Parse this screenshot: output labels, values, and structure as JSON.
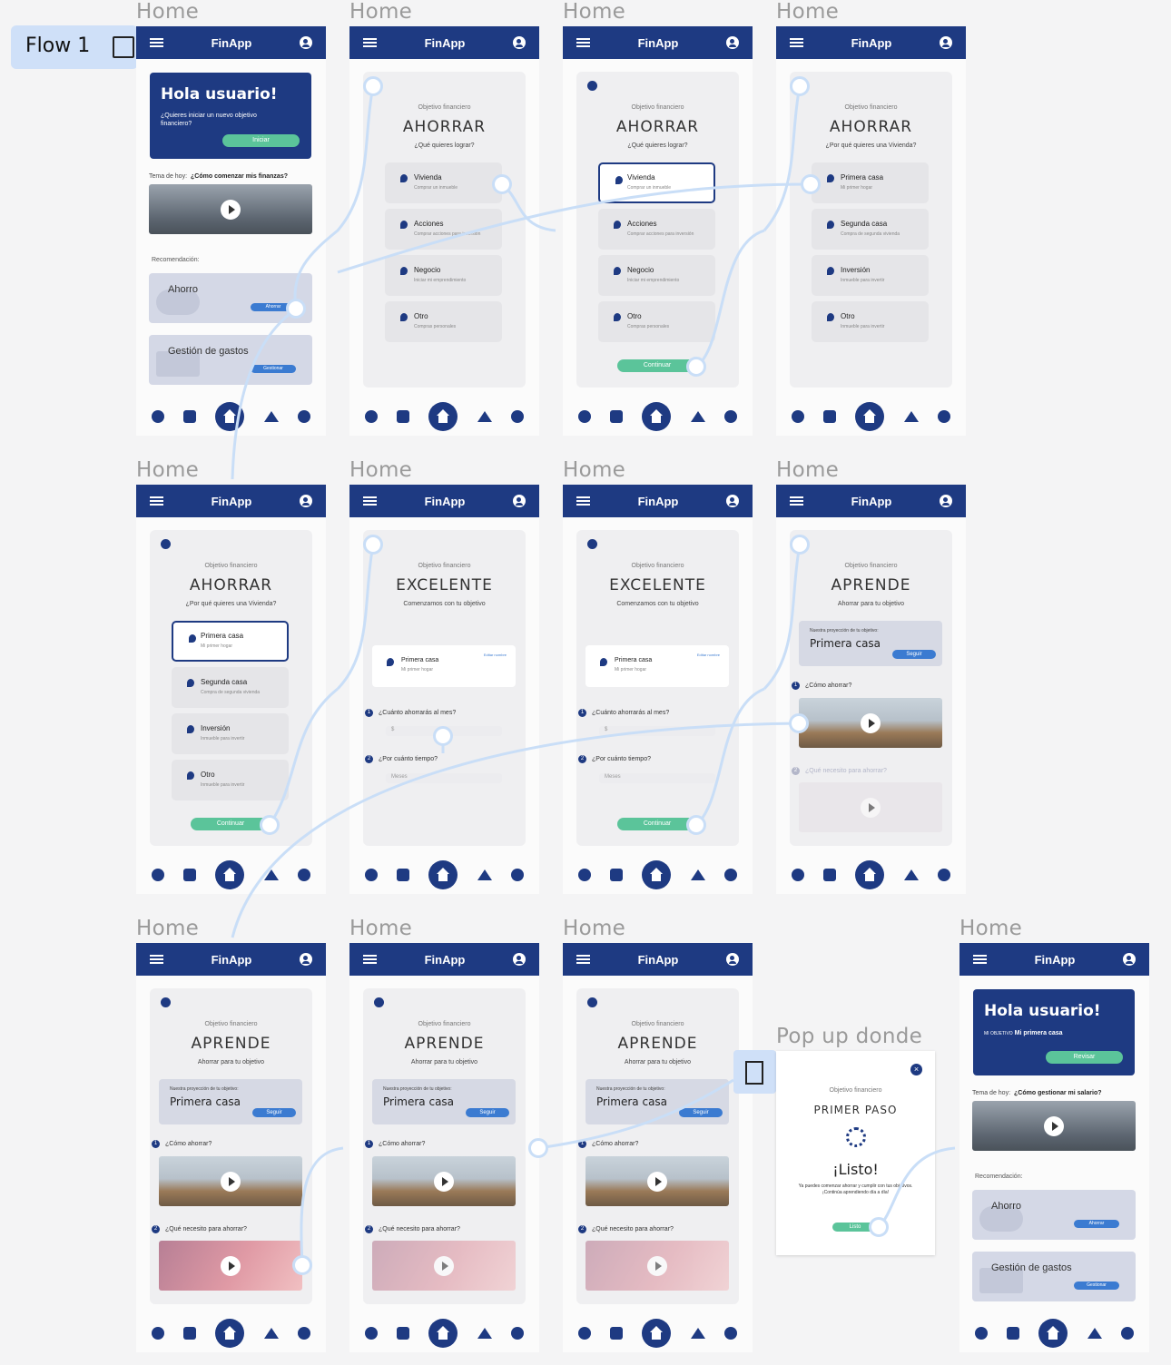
{
  "flow": {
    "label": "Flow 1"
  },
  "frame_label": "Home",
  "popup_label": "Pop up donde",
  "app": {
    "title": "FinApp"
  },
  "home": {
    "greeting": "Hola usuario!",
    "question": "¿Quieres iniciar un nuevo objetivo financiero?",
    "start": "Iniciar",
    "tema_label": "Tema de hoy:",
    "tema_value": "¿Cómo comenzar mis finanzas?",
    "reco_label": "Recomendación:",
    "reco1": "Ahorro",
    "reco1_btn": "Ahorrar",
    "reco2": "Gestión de gastos",
    "reco2_btn": "Gestionar"
  },
  "home2": {
    "greeting": "Hola usuario!",
    "obj_small": "MI OBJETIVO",
    "obj_value": "Mi primera casa",
    "review": "Revisar",
    "tema_label": "Tema de hoy:",
    "tema_value": "¿Cómo gestionar mi salario?",
    "reco_label": "Recomendación:",
    "reco1": "Ahorro",
    "reco1_btn": "Ahorrar",
    "reco2": "Gestión de gastos",
    "reco2_btn": "Gestionar"
  },
  "obj": {
    "label": "Objetivo financiero",
    "ahorrar": "AHORRAR",
    "q1": "¿Qué quieres lograr?",
    "q2": "¿Por qué quieres una Vivienda?",
    "excelente": "EXCELENTE",
    "excelente_sub": "Comenzamos con tu objetivo",
    "aprende": "APRENDE",
    "aprende_sub": "Ahorrar para tu objetivo",
    "continuar": "Continuar"
  },
  "options1": [
    {
      "t": "Vivienda",
      "s": "Comprar un inmueble"
    },
    {
      "t": "Acciones",
      "s": "Comprar acciones para inversión"
    },
    {
      "t": "Negocio",
      "s": "Iniciar mi emprendimiento"
    },
    {
      "t": "Otro",
      "s": "Compras personales"
    }
  ],
  "options2": [
    {
      "t": "Primera casa",
      "s": "Mi primer hogar"
    },
    {
      "t": "Segunda casa",
      "s": "Compra de segunda vivienda"
    },
    {
      "t": "Inversión",
      "s": "Inmueble para invertir"
    },
    {
      "t": "Otro",
      "s": "Inmueble para invertir"
    }
  ],
  "excelente": {
    "goal_t": "Primera casa",
    "goal_s": "Mi primer hogar",
    "edit": "Editar nombre",
    "q1": "¿Cuánto ahorrarás al mes?",
    "q1_ph": "$",
    "q2": "¿Por cuánto tiempo?",
    "q2_ph": "Meses"
  },
  "aprende": {
    "proj_s": "Nuestra proyección de tu objetivo:",
    "proj_t": "Primera casa",
    "seguir": "Seguir",
    "s1": "¿Cómo ahorrar?",
    "s2": "¿Qué necesito para ahorrar?"
  },
  "popup": {
    "label": "Objetivo financiero",
    "title": "PRIMER PASO",
    "done": "¡Listo!",
    "text": "Ya puedes comenzar ahorrar y cumplir con tus objetivos. ¡Continúa aprendiendo día a día!",
    "btn": "Listo"
  },
  "colors": {
    "brand": "#1e3a82",
    "green": "#5bc49a",
    "blue": "#3b7bd1",
    "flowline": "#c9def7"
  }
}
